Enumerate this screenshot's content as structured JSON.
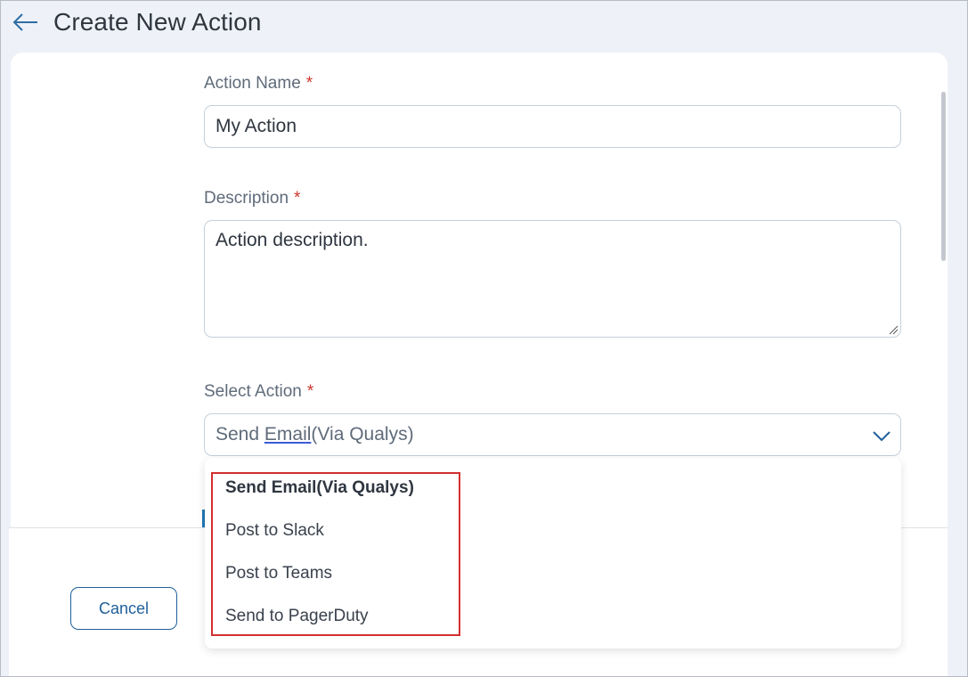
{
  "header": {
    "title": "Create New Action",
    "back_icon": "arrow-left-icon"
  },
  "form": {
    "action_name": {
      "label": "Action Name",
      "required_mark": "*",
      "value": "My Action"
    },
    "description": {
      "label": "Description",
      "required_mark": "*",
      "value": "Action description."
    },
    "select_action": {
      "label": "Select Action",
      "required_mark": "*",
      "value_prefix": "Send ",
      "value_underlined": "Email",
      "value_suffix": "(Via Qualys)",
      "chevron_icon": "chevron-down-icon",
      "options": [
        "Send Email(Via Qualys)",
        "Post to Slack",
        "Post to Teams",
        "Send to PagerDuty"
      ],
      "selected_index": 0
    }
  },
  "footer": {
    "cancel_label": "Cancel"
  },
  "colors": {
    "accent": "#1f5f9a",
    "required": "#d0342c",
    "highlight": "#d32f2f",
    "background": "#eef2f8"
  }
}
